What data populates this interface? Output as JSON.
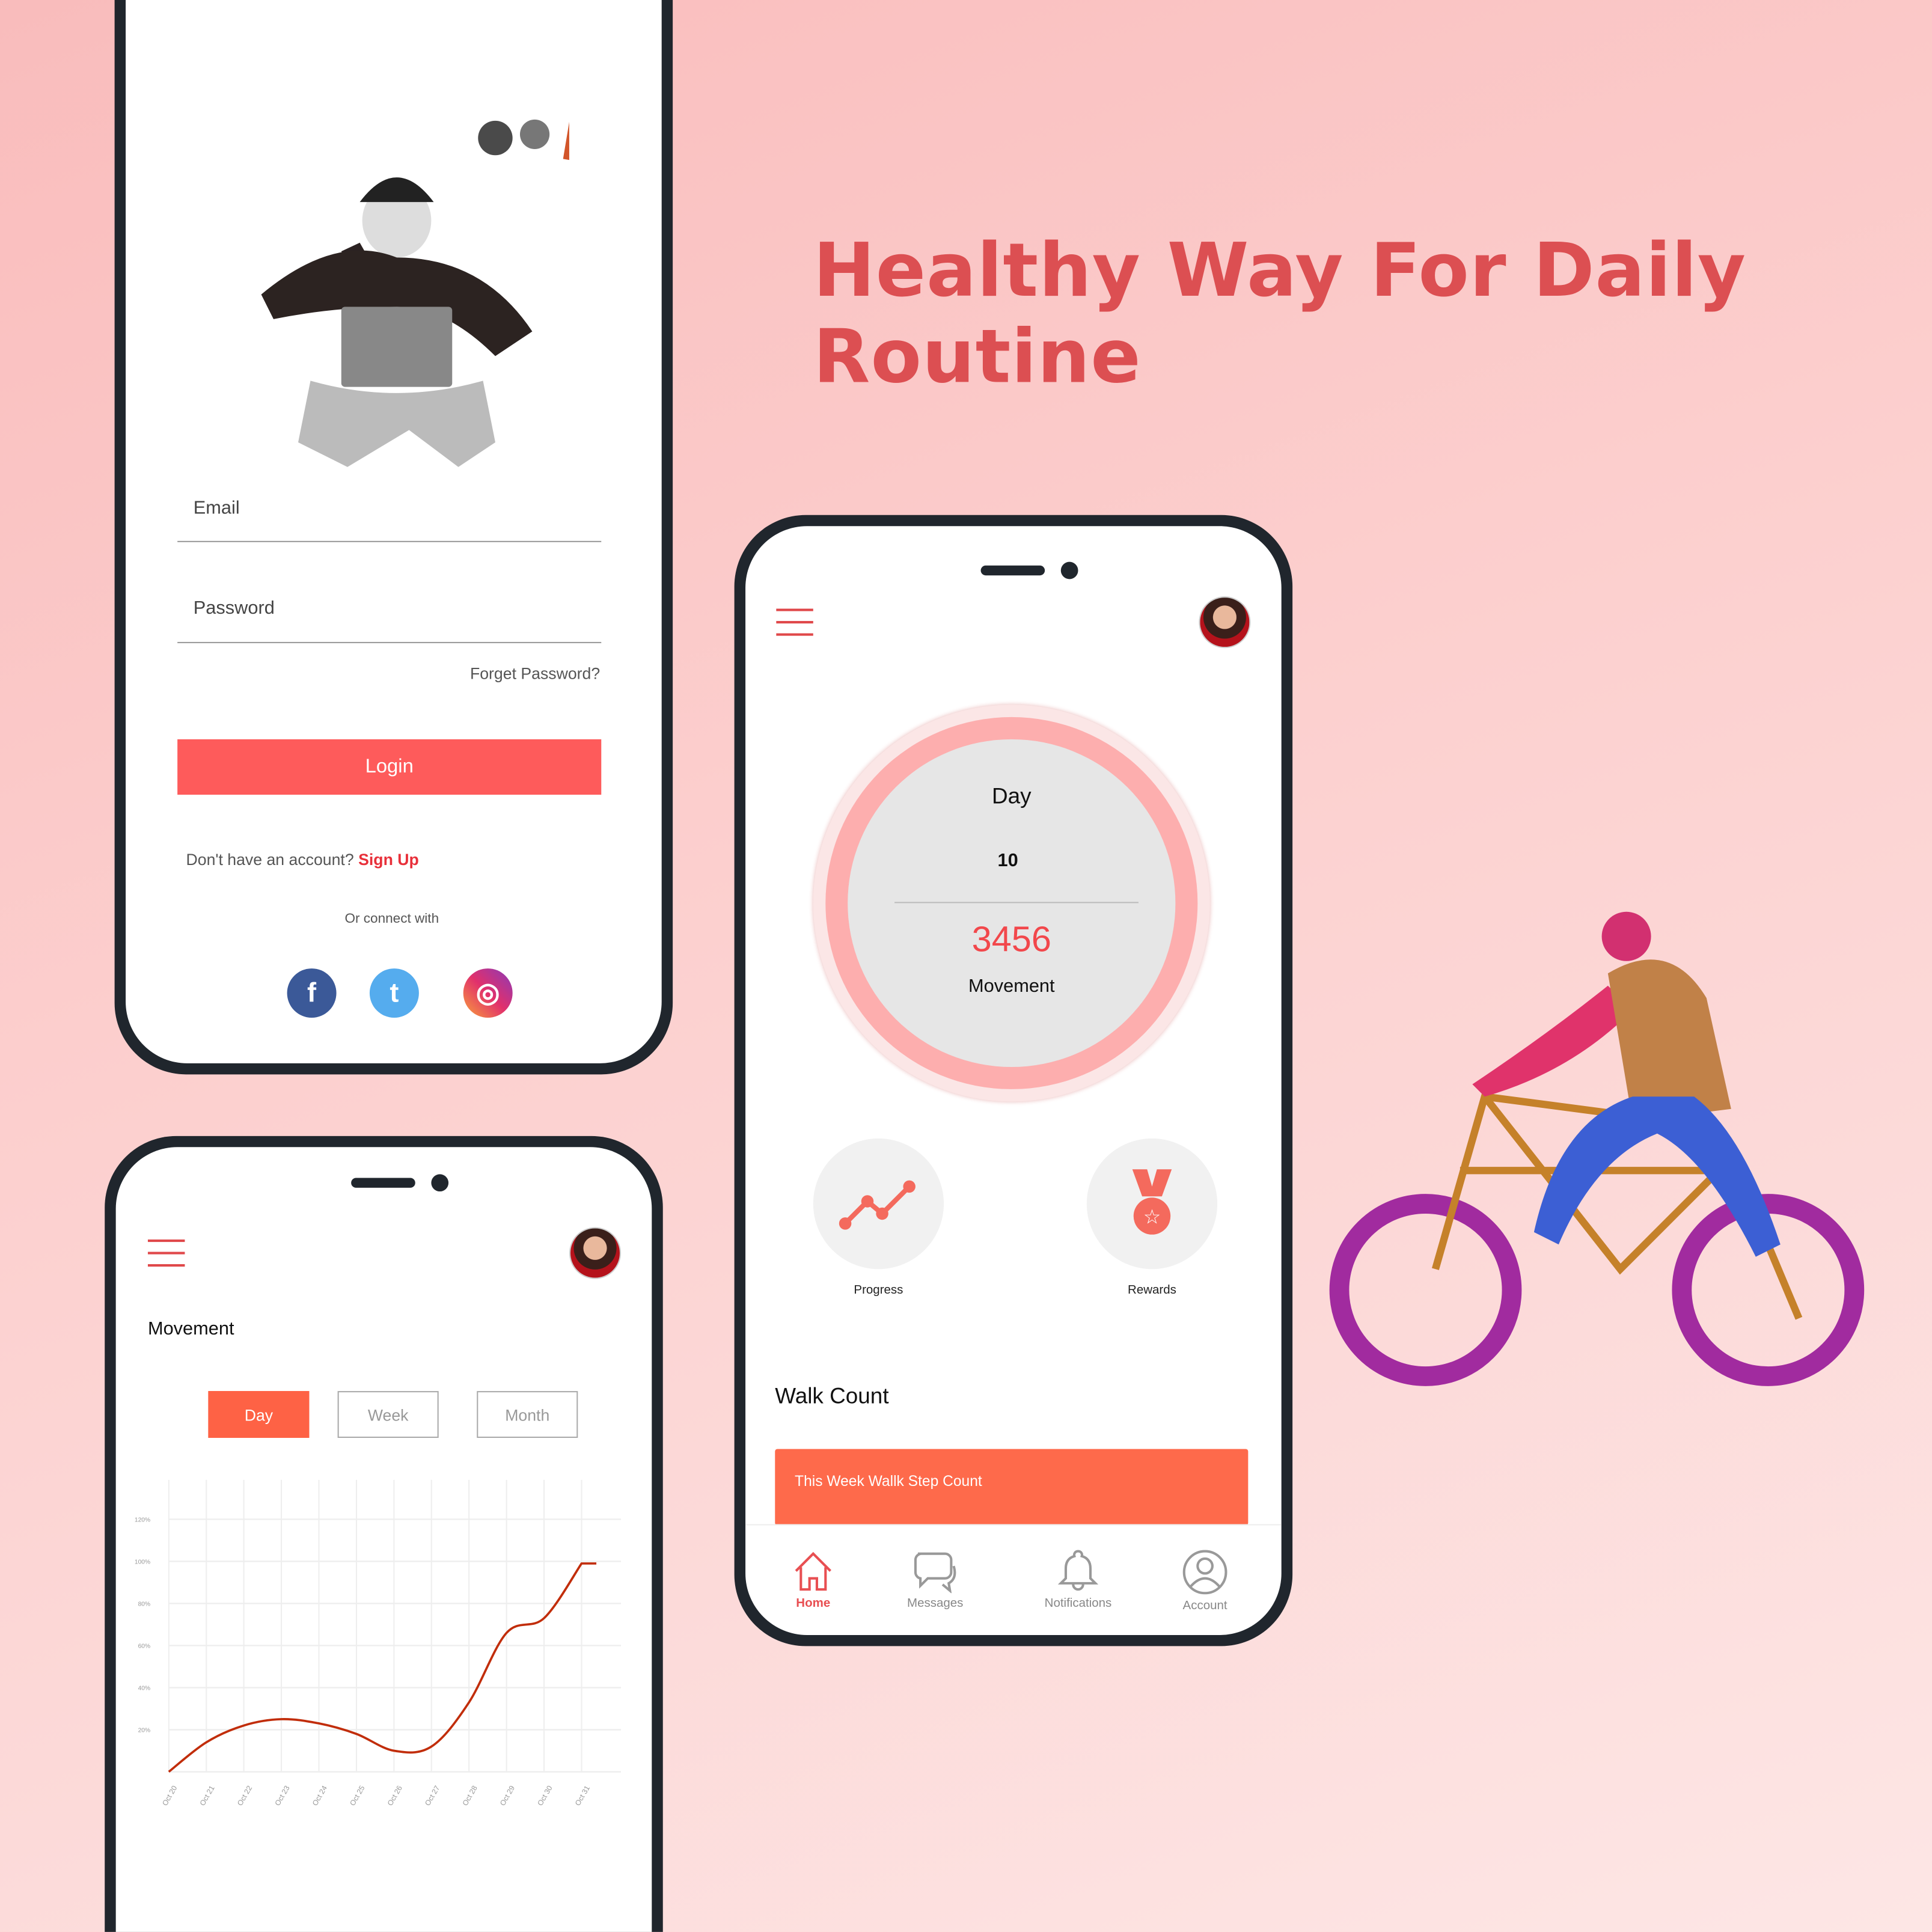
{
  "headline": "Healthy Way For Daily Routine",
  "login_screen": {
    "email_label": "Email",
    "password_label": "Password",
    "forgot_password": "Forget Password?",
    "login_button": "Login",
    "no_account": "Don't have an account?",
    "sign_up": "Sign Up",
    "connect_with": "Or connect with",
    "social": [
      {
        "name": "facebook",
        "glyph": "f",
        "color": "#3b5998"
      },
      {
        "name": "twitter",
        "glyph": "t",
        "color": "#55acee"
      },
      {
        "name": "instagram",
        "glyph": "◎",
        "color": "#e1306c"
      }
    ]
  },
  "home_screen": {
    "ring": {
      "label_top": "Day",
      "day_value": "10",
      "steps": "3456",
      "steps_label": "Movement"
    },
    "actions": [
      {
        "label": "Progress",
        "icon": "trend-line-icon"
      },
      {
        "label": "Rewards",
        "icon": "medal-icon"
      }
    ],
    "walk_count_title": "Walk Count",
    "walk_card_text": "This Week  Wallk Step Count",
    "nav": [
      {
        "label": "Home",
        "icon": "home-icon",
        "active": true
      },
      {
        "label": "Messages",
        "icon": "chat-bubbles-icon",
        "active": false
      },
      {
        "label": "Notifications",
        "icon": "bell-icon",
        "active": false
      },
      {
        "label": "Account",
        "icon": "user-circle-icon",
        "active": false
      }
    ]
  },
  "movement_screen": {
    "title": "Movement",
    "tabs": [
      {
        "label": "Day",
        "active": true
      },
      {
        "label": "Week",
        "active": false
      },
      {
        "label": "Month",
        "active": false
      }
    ]
  },
  "colors": {
    "accent": "#fe5b5b",
    "orange": "#fe6a4b",
    "headline": "#dc4f52",
    "line": "#c12d0a"
  },
  "chart_data": {
    "type": "line",
    "x": [
      "Oct 20",
      "Oct 21",
      "Oct 22",
      "Oct 23",
      "Oct 24",
      "Oct 25",
      "Oct 26",
      "Oct 27",
      "Oct 28",
      "Oct 29",
      "Oct 30",
      "Oct 31"
    ],
    "values": [
      0,
      14,
      22,
      25,
      23,
      18,
      10,
      12,
      33,
      66,
      73,
      99
    ],
    "yticks": [
      "20%",
      "40%",
      "60%",
      "80%",
      "100%",
      "120%"
    ],
    "ylim": [
      0,
      130
    ],
    "grid": true,
    "smooth": true
  }
}
